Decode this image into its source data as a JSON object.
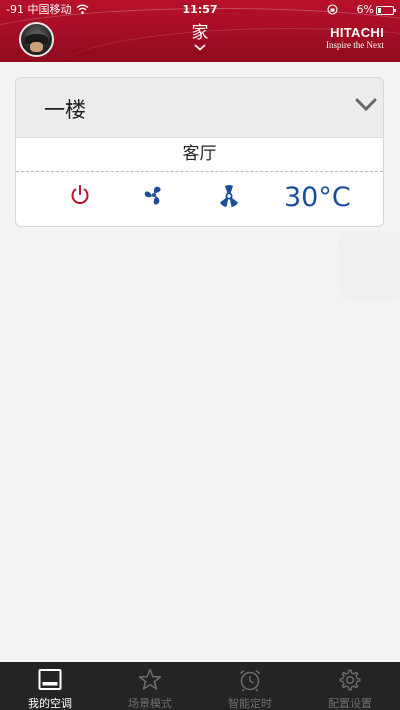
{
  "status_bar": {
    "carrier": "-91 中国移动",
    "time": "11:57",
    "battery_percent": "6%"
  },
  "header": {
    "title": "家",
    "brand_name": "HITACHI",
    "brand_tagline": "Inspire the Next",
    "theme_color": "#b8102a"
  },
  "unit_card": {
    "floor": "一楼",
    "room": "客厅",
    "temperature": "30°C",
    "power_color": "#b3152f",
    "icon_color": "#1b4f9b"
  },
  "tabs": [
    {
      "label": "我的空调",
      "icon": "ac-unit-icon",
      "active": true
    },
    {
      "label": "场景模式",
      "icon": "star-icon",
      "active": false
    },
    {
      "label": "智能定时",
      "icon": "alarm-clock-icon",
      "active": false
    },
    {
      "label": "配置设置",
      "icon": "gear-icon",
      "active": false
    }
  ]
}
